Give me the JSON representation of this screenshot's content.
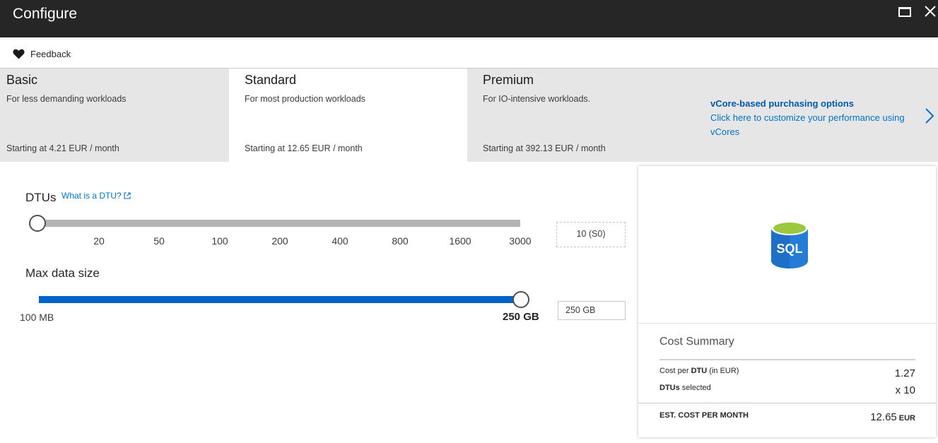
{
  "window": {
    "title": "Configure"
  },
  "toolbar": {
    "feedback_label": "Feedback"
  },
  "tiers": [
    {
      "name": "Basic",
      "description": "For less demanding workloads",
      "price": "Starting at 4.21 EUR / month",
      "selected": false
    },
    {
      "name": "Standard",
      "description": "For most production workloads",
      "price": "Starting at 12.65 EUR / month",
      "selected": true
    },
    {
      "name": "Premium",
      "description": "For IO-intensive workloads.",
      "price": "Starting at 392.13 EUR / month",
      "selected": false
    }
  ],
  "vcore": {
    "title": "vCore-based purchasing options",
    "body": "Click here to customize your performance using vCores"
  },
  "dtu": {
    "label": "DTUs",
    "help_link": "What is a DTU?",
    "ticks": [
      "20",
      "50",
      "100",
      "200",
      "400",
      "800",
      "1600",
      "3000"
    ],
    "value": "10 (S0)",
    "slider_fraction": 0
  },
  "max_size": {
    "label": "Max data size",
    "min_label": "100 MB",
    "max_label": "250 GB",
    "value": "250 GB",
    "slider_fraction": 1
  },
  "cost_summary": {
    "icon_text": "SQL",
    "title": "Cost Summary",
    "cost_per_dtu_prefix": "Cost per ",
    "cost_per_dtu_bold": "DTU",
    "cost_per_dtu_suffix": " (in EUR)",
    "cost_per_dtu_value": "1.27",
    "dtus_selected_bold": "DTUs",
    "dtus_selected_suffix": " selected",
    "dtus_selected_value": "x 10",
    "total_label": "EST. COST PER MONTH",
    "total_value": "12.65",
    "total_unit": "EUR"
  },
  "colors": {
    "titlebar": "#262626",
    "accent_blue": "#0063c8",
    "link_blue": "#0072c6",
    "tier_bg": "#e6e6e6"
  }
}
